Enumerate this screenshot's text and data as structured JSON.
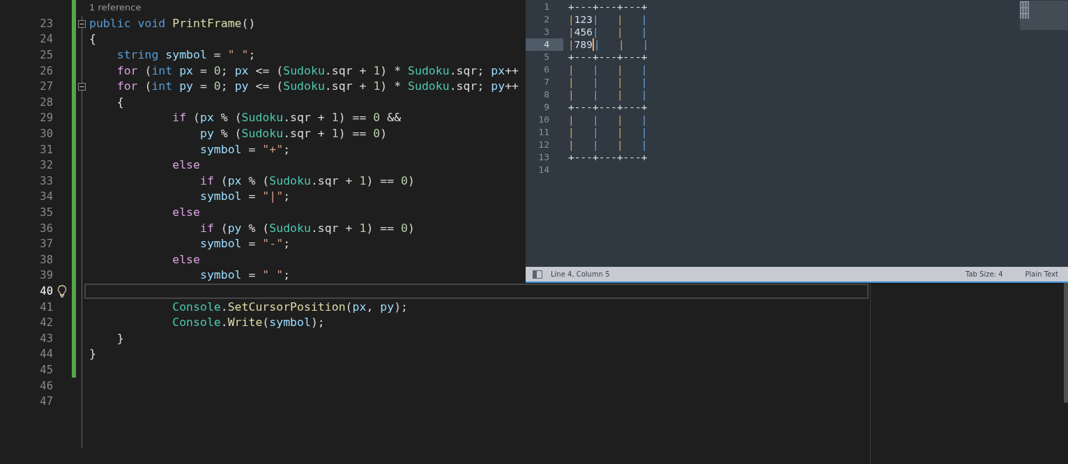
{
  "editor": {
    "codelens": "1 reference",
    "lines": [
      {
        "number": "23",
        "changed": true,
        "fold_start": true,
        "tokens": [
          {
            "kind": "keyword",
            "text": "public"
          },
          {
            "kind": "keyword",
            "text": " void"
          },
          {
            "kind": "method",
            "text": " PrintFrame"
          },
          {
            "kind": "plain",
            "text": "()"
          }
        ]
      },
      {
        "number": "24",
        "changed": true,
        "tokens": [
          {
            "kind": "plain",
            "text": "{"
          }
        ]
      },
      {
        "number": "25",
        "changed": true,
        "tokens": [
          {
            "kind": "keyword",
            "text": "    string"
          },
          {
            "kind": "variable",
            "text": " symbol"
          },
          {
            "kind": "plain",
            "text": " = "
          },
          {
            "kind": "string",
            "text": "\" \""
          },
          {
            "kind": "plain",
            "text": ";"
          }
        ]
      },
      {
        "number": "26",
        "changed": true,
        "tokens": [
          {
            "kind": "control",
            "text": "    for"
          },
          {
            "kind": "plain",
            "text": " ("
          },
          {
            "kind": "keyword",
            "text": "int"
          },
          {
            "kind": "variable",
            "text": " px"
          },
          {
            "kind": "plain",
            "text": " = "
          },
          {
            "kind": "number",
            "text": "0"
          },
          {
            "kind": "plain",
            "text": "; "
          },
          {
            "kind": "variable",
            "text": "px"
          },
          {
            "kind": "plain",
            "text": " <= ("
          },
          {
            "kind": "type",
            "text": "Sudoku"
          },
          {
            "kind": "plain",
            "text": ".sqr + "
          },
          {
            "kind": "number",
            "text": "1"
          },
          {
            "kind": "plain",
            "text": ") * "
          },
          {
            "kind": "type",
            "text": "Sudoku"
          },
          {
            "kind": "plain",
            "text": ".sqr; "
          },
          {
            "kind": "variable",
            "text": "px"
          },
          {
            "kind": "plain",
            "text": "++"
          }
        ]
      },
      {
        "number": "27",
        "changed": true,
        "fold_start": true,
        "tokens": [
          {
            "kind": "control",
            "text": "    for"
          },
          {
            "kind": "plain",
            "text": " ("
          },
          {
            "kind": "keyword",
            "text": "int"
          },
          {
            "kind": "variable",
            "text": " py"
          },
          {
            "kind": "plain",
            "text": " = "
          },
          {
            "kind": "number",
            "text": "0"
          },
          {
            "kind": "plain",
            "text": "; "
          },
          {
            "kind": "variable",
            "text": "py"
          },
          {
            "kind": "plain",
            "text": " <= ("
          },
          {
            "kind": "type",
            "text": "Sudoku"
          },
          {
            "kind": "plain",
            "text": ".sqr + "
          },
          {
            "kind": "number",
            "text": "1"
          },
          {
            "kind": "plain",
            "text": ") * "
          },
          {
            "kind": "type",
            "text": "Sudoku"
          },
          {
            "kind": "plain",
            "text": ".sqr; "
          },
          {
            "kind": "variable",
            "text": "py"
          },
          {
            "kind": "plain",
            "text": "++"
          }
        ]
      },
      {
        "number": "28",
        "changed": true,
        "tokens": [
          {
            "kind": "plain",
            "text": "    {"
          }
        ]
      },
      {
        "number": "29",
        "changed": true,
        "tokens": [
          {
            "kind": "control",
            "text": "            if"
          },
          {
            "kind": "plain",
            "text": " ("
          },
          {
            "kind": "variable",
            "text": "px"
          },
          {
            "kind": "plain",
            "text": " % ("
          },
          {
            "kind": "type",
            "text": "Sudoku"
          },
          {
            "kind": "plain",
            "text": ".sqr + "
          },
          {
            "kind": "number",
            "text": "1"
          },
          {
            "kind": "plain",
            "text": ") == "
          },
          {
            "kind": "number",
            "text": "0"
          },
          {
            "kind": "plain",
            "text": " &&"
          }
        ]
      },
      {
        "number": "30",
        "changed": true,
        "tokens": [
          {
            "kind": "variable",
            "text": "                py"
          },
          {
            "kind": "plain",
            "text": " % ("
          },
          {
            "kind": "type",
            "text": "Sudoku"
          },
          {
            "kind": "plain",
            "text": ".sqr + "
          },
          {
            "kind": "number",
            "text": "1"
          },
          {
            "kind": "plain",
            "text": ") == "
          },
          {
            "kind": "number",
            "text": "0"
          },
          {
            "kind": "plain",
            "text": ")"
          }
        ]
      },
      {
        "number": "31",
        "changed": true,
        "tokens": [
          {
            "kind": "variable",
            "text": "                symbol"
          },
          {
            "kind": "plain",
            "text": " = "
          },
          {
            "kind": "string",
            "text": "\"+\""
          },
          {
            "kind": "plain",
            "text": ";"
          }
        ]
      },
      {
        "number": "32",
        "changed": true,
        "tokens": [
          {
            "kind": "control",
            "text": "            else"
          }
        ]
      },
      {
        "number": "33",
        "changed": true,
        "tokens": [
          {
            "kind": "control",
            "text": "                if"
          },
          {
            "kind": "plain",
            "text": " ("
          },
          {
            "kind": "variable",
            "text": "px"
          },
          {
            "kind": "plain",
            "text": " % ("
          },
          {
            "kind": "type",
            "text": "Sudoku"
          },
          {
            "kind": "plain",
            "text": ".sqr + "
          },
          {
            "kind": "number",
            "text": "1"
          },
          {
            "kind": "plain",
            "text": ") == "
          },
          {
            "kind": "number",
            "text": "0"
          },
          {
            "kind": "plain",
            "text": ")"
          }
        ]
      },
      {
        "number": "34",
        "changed": true,
        "tokens": [
          {
            "kind": "variable",
            "text": "                symbol"
          },
          {
            "kind": "plain",
            "text": " = "
          },
          {
            "kind": "string",
            "text": "\"|\""
          },
          {
            "kind": "plain",
            "text": ";"
          }
        ]
      },
      {
        "number": "35",
        "changed": true,
        "tokens": [
          {
            "kind": "control",
            "text": "            else"
          }
        ]
      },
      {
        "number": "36",
        "changed": true,
        "tokens": [
          {
            "kind": "control",
            "text": "                if"
          },
          {
            "kind": "plain",
            "text": " ("
          },
          {
            "kind": "variable",
            "text": "py"
          },
          {
            "kind": "plain",
            "text": " % ("
          },
          {
            "kind": "type",
            "text": "Sudoku"
          },
          {
            "kind": "plain",
            "text": ".sqr + "
          },
          {
            "kind": "number",
            "text": "1"
          },
          {
            "kind": "plain",
            "text": ") == "
          },
          {
            "kind": "number",
            "text": "0"
          },
          {
            "kind": "plain",
            "text": ")"
          }
        ]
      },
      {
        "number": "37",
        "changed": true,
        "tokens": [
          {
            "kind": "variable",
            "text": "                symbol"
          },
          {
            "kind": "plain",
            "text": " = "
          },
          {
            "kind": "string",
            "text": "\"-\""
          },
          {
            "kind": "plain",
            "text": ";"
          }
        ]
      },
      {
        "number": "38",
        "changed": true,
        "tokens": [
          {
            "kind": "control",
            "text": "            else"
          }
        ]
      },
      {
        "number": "39",
        "changed": true,
        "tokens": [
          {
            "kind": "variable",
            "text": "                symbol"
          },
          {
            "kind": "plain",
            "text": " = "
          },
          {
            "kind": "string",
            "text": "\" \""
          },
          {
            "kind": "plain",
            "text": ";"
          }
        ]
      },
      {
        "number": "40",
        "changed": true,
        "current": true,
        "lightbulb": true
      },
      {
        "number": "41",
        "changed": true,
        "tokens": [
          {
            "kind": "type",
            "text": "            Console"
          },
          {
            "kind": "plain",
            "text": "."
          },
          {
            "kind": "method",
            "text": "SetCursorPosition"
          },
          {
            "kind": "plain",
            "text": "("
          },
          {
            "kind": "variable",
            "text": "px"
          },
          {
            "kind": "plain",
            "text": ", "
          },
          {
            "kind": "variable",
            "text": "py"
          },
          {
            "kind": "plain",
            "text": ");"
          }
        ]
      },
      {
        "number": "42",
        "changed": true,
        "tokens": [
          {
            "kind": "type",
            "text": "            Console"
          },
          {
            "kind": "plain",
            "text": "."
          },
          {
            "kind": "method",
            "text": "Write"
          },
          {
            "kind": "plain",
            "text": "("
          },
          {
            "kind": "variable",
            "text": "symbol"
          },
          {
            "kind": "plain",
            "text": ");"
          }
        ]
      },
      {
        "number": "43",
        "changed": true,
        "tokens": [
          {
            "kind": "plain",
            "text": "    }"
          }
        ]
      },
      {
        "number": "44",
        "changed": true,
        "tokens": [
          {
            "kind": "plain",
            "text": "}"
          }
        ]
      },
      {
        "number": "45",
        "changed": true
      },
      {
        "number": "46",
        "changed": false
      },
      {
        "number": "47",
        "changed": false
      }
    ]
  },
  "text_window": {
    "lines": [
      {
        "number": "1",
        "text": "+---+---+---+"
      },
      {
        "number": "2",
        "text": "|123|   |   |"
      },
      {
        "number": "3",
        "text": "|456|   |   |"
      },
      {
        "number": "4",
        "current": true,
        "text_before_cursor": "|789",
        "text_after_cursor": "|   |   |"
      },
      {
        "number": "5",
        "text": "+---+---+---+"
      },
      {
        "number": "6",
        "text": "|   |   |   |"
      },
      {
        "number": "7",
        "text": "|   |   |   |"
      },
      {
        "number": "8",
        "text": "|   |   |   |"
      },
      {
        "number": "9",
        "text": "+---+---+---+"
      },
      {
        "number": "10",
        "text": "|   |   |   |"
      },
      {
        "number": "11",
        "text": "|   |   |   |"
      },
      {
        "number": "12",
        "text": "|   |   |   |"
      },
      {
        "number": "13",
        "text": "+---+---+---+"
      },
      {
        "number": "14"
      }
    ],
    "status_bar": {
      "position": "Line 4, Column 5",
      "tab_size": "Tab Size: 4",
      "syntax": "Plain Text"
    }
  }
}
